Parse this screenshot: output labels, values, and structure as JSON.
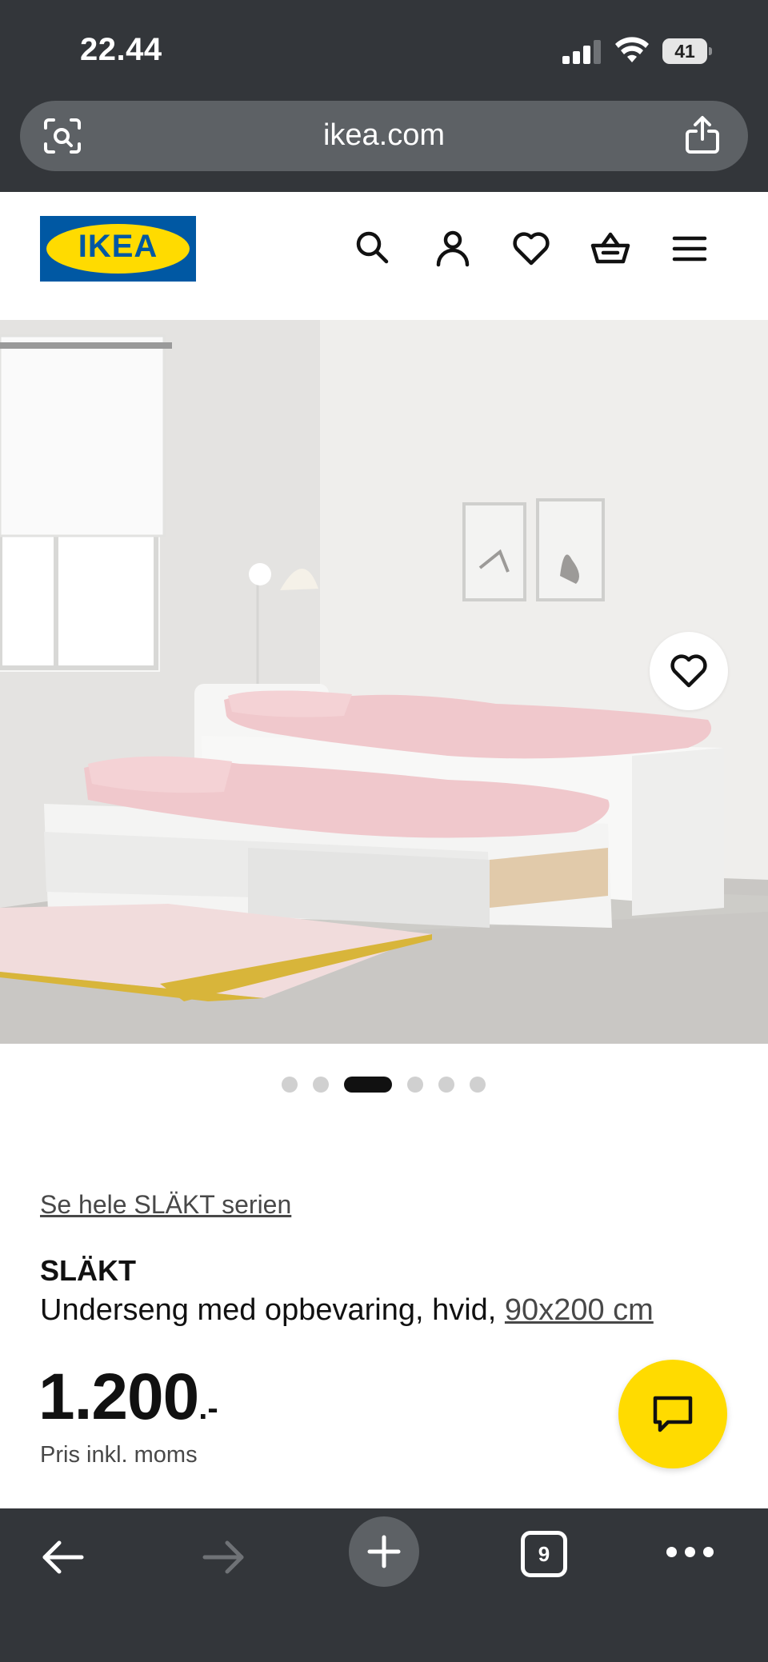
{
  "status_bar": {
    "time": "22.44",
    "battery": "41"
  },
  "browser": {
    "url": "ikea.com",
    "tab_count": "9"
  },
  "header": {
    "logo_text": "IKEA",
    "icons": [
      "search-icon",
      "user-icon",
      "heart-icon",
      "basket-icon",
      "menu-icon"
    ]
  },
  "gallery": {
    "image_count": 6,
    "active_index": 2
  },
  "product": {
    "series_link": "Se hele SLÄKT serien",
    "name": "SLÄKT",
    "description": "Underseng med opbevaring, hvid, ",
    "size": "90x200 cm",
    "price_main": "1.200",
    "price_suffix": ".-",
    "price_note": "Pris inkl. moms"
  },
  "colors": {
    "ikea_blue": "#0058a3",
    "ikea_yellow": "#ffdb00",
    "browser_chrome": "#33363a"
  }
}
